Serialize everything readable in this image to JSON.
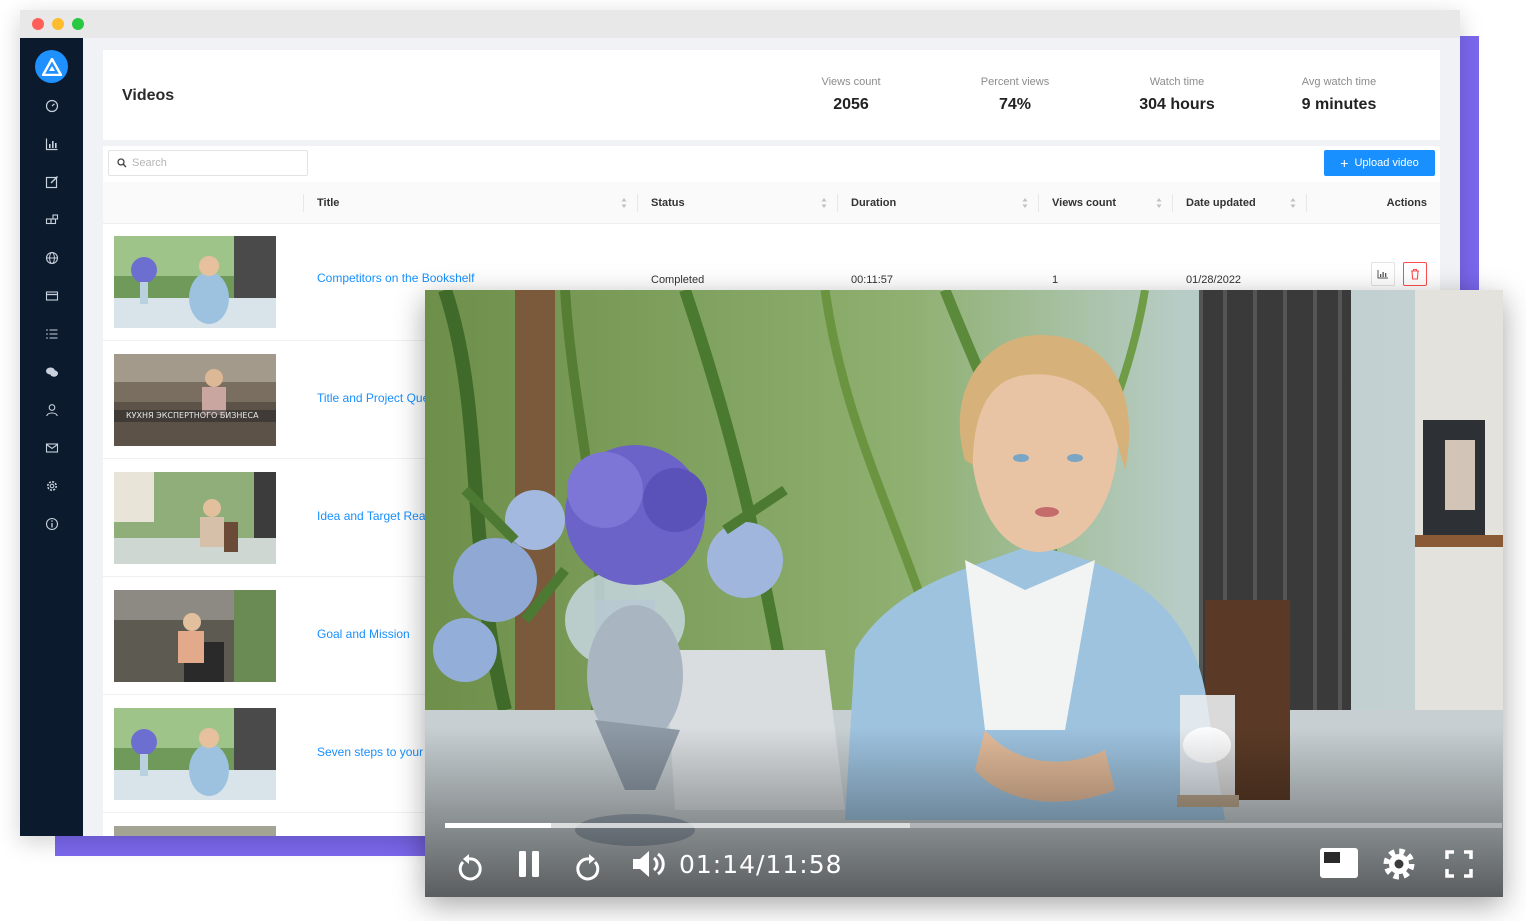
{
  "page": {
    "title": "Videos",
    "stats": [
      {
        "label": "Views count",
        "value": "2056"
      },
      {
        "label": "Percent views",
        "value": "74%"
      },
      {
        "label": "Watch time",
        "value": "304 hours"
      },
      {
        "label": "Avg watch time",
        "value": "9 minutes"
      }
    ]
  },
  "toolbar": {
    "search_placeholder": "Search",
    "upload_label": "Upload video"
  },
  "table": {
    "columns": [
      "Title",
      "Status",
      "Duration",
      "Views count",
      "Date updated",
      "Actions"
    ],
    "rows": [
      {
        "title": "Competitors on the Bookshelf",
        "status": "Completed",
        "duration": "00:11:57",
        "views": "1",
        "date": "01/28/2022"
      },
      {
        "title": "Title and Project Que"
      },
      {
        "title": "Idea and Target Rea"
      },
      {
        "title": "Goal and Mission"
      },
      {
        "title": "Seven steps to your"
      }
    ],
    "thumb_caption": "КУХНЯ ЭКСПЕРТНОГО БИЗНЕСА"
  },
  "player": {
    "time_display": "01:14/11:58",
    "progress_fraction": 0.1,
    "buffer_fraction": 0.44
  },
  "colors": {
    "sidebar": "#0b1a2c",
    "accent": "#1890ff",
    "backdrop": "#7b68ee",
    "danger": "#ff4d4f"
  },
  "icons": {
    "sidebar": [
      "dashboard-icon",
      "chart-icon",
      "edit-icon",
      "blocks-icon",
      "globe-icon",
      "card-icon",
      "list-icon",
      "chat-icon",
      "user-icon",
      "mail-icon",
      "settings-icon",
      "info-icon"
    ],
    "player": [
      "rewind-icon",
      "pause-icon",
      "forward-icon",
      "volume-icon",
      "pip-icon",
      "settings-icon",
      "fullscreen-icon"
    ]
  }
}
